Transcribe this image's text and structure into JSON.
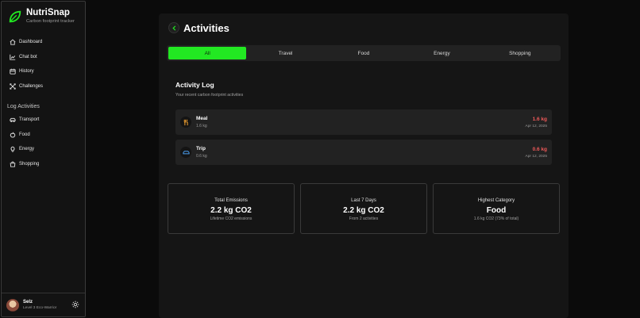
{
  "app": {
    "name": "NutriSnap",
    "tagline": "Carbon footprint tracker"
  },
  "sidebar": {
    "items": [
      {
        "label": "Dashboard",
        "icon": "home-icon"
      },
      {
        "label": "Chat bot",
        "icon": "chart-icon"
      },
      {
        "label": "History",
        "icon": "calendar-icon"
      },
      {
        "label": "Challenges",
        "icon": "challenges-icon"
      }
    ],
    "section_label": "Log Activities",
    "log_items": [
      {
        "label": "Transport",
        "icon": "car-icon"
      },
      {
        "label": "Food",
        "icon": "apple-icon"
      },
      {
        "label": "Energy",
        "icon": "lightbulb-icon"
      },
      {
        "label": "Shopping",
        "icon": "shopping-icon"
      }
    ]
  },
  "user": {
    "name": "Selz",
    "level": "Level 3 Eco-Warrior"
  },
  "page": {
    "title": "Activities"
  },
  "tabs": [
    {
      "label": "All",
      "active": true
    },
    {
      "label": "Travel",
      "active": false
    },
    {
      "label": "Food",
      "active": false
    },
    {
      "label": "Energy",
      "active": false
    },
    {
      "label": "Shopping",
      "active": false
    }
  ],
  "activity_log": {
    "title": "Activity Log",
    "subtitle": "Your recent carbon footprint activities",
    "items": [
      {
        "name": "Meal",
        "detail": "1.6 kg",
        "amount": "1.6 kg",
        "date": "Apr 12, 2025",
        "icon": "fork-knife-icon"
      },
      {
        "name": "Trip",
        "detail": "0.6 kg",
        "amount": "0.6 kg",
        "date": "Apr 12, 2025",
        "icon": "car-icon"
      }
    ]
  },
  "stats": [
    {
      "label": "Total Emissions",
      "value": "2.2 kg CO2",
      "sub": "Lifetime CO2 emissions"
    },
    {
      "label": "Last 7 Days",
      "value": "2.2 kg CO2",
      "sub": "From 2 activities"
    },
    {
      "label": "Highest Category",
      "value": "Food",
      "sub": "1.6 kg CO2 (73% of total)"
    }
  ],
  "colors": {
    "accent": "#22e822",
    "emission": "#ef5a5a",
    "background": "#0b0b0b",
    "panel": "#151515"
  }
}
